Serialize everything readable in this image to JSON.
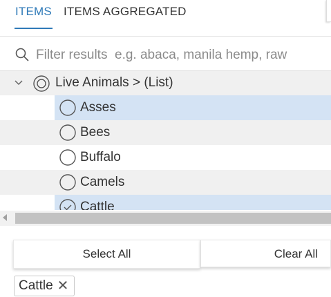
{
  "tabs": [
    {
      "label": "ITEMS",
      "active": true
    },
    {
      "label": "ITEMS AGGREGATED",
      "active": false
    }
  ],
  "search": {
    "placeholder": "Filter results  e.g. abaca, manila hemp, raw",
    "value": "",
    "icon": "search-icon"
  },
  "tree": {
    "parent": {
      "label": "Live Animals > (List)",
      "expanded": true,
      "icon": "chevron-down-icon"
    },
    "items": [
      {
        "label": "Asses",
        "selected": false,
        "highlighted": true
      },
      {
        "label": "Bees",
        "selected": false,
        "highlighted": false
      },
      {
        "label": "Buffalo",
        "selected": false,
        "highlighted": false
      },
      {
        "label": "Camels",
        "selected": false,
        "highlighted": false
      },
      {
        "label": "Cattle",
        "selected": true,
        "highlighted": true
      }
    ]
  },
  "buttons": {
    "select_all": "Select All",
    "clear_all": "Clear All"
  },
  "chips": [
    {
      "label": "Cattle",
      "close": "✕"
    }
  ],
  "colors": {
    "accent": "#2f7ab8",
    "highlight": "#d4e3f4",
    "stripe": "#f0f0f0"
  }
}
